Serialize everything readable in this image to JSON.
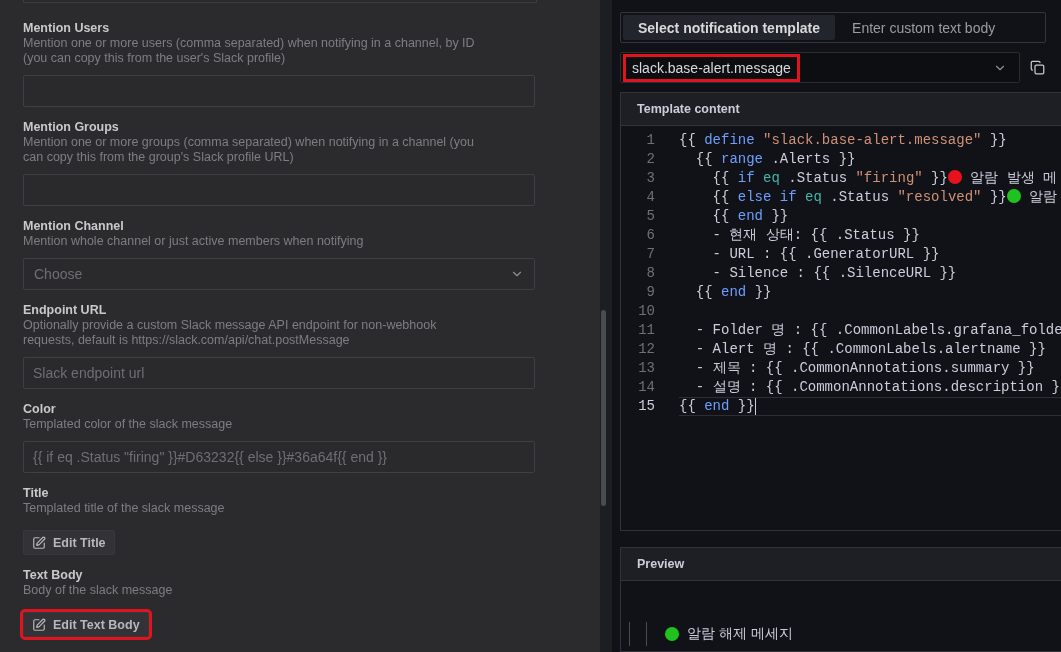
{
  "settings_form": {
    "fields": [
      {
        "kind": "input",
        "label": "Mention Users",
        "description": [
          "Mention one or more users (comma separated) when notifying in a channel, by ID",
          "(you can copy this from the user's Slack profile)"
        ]
      },
      {
        "kind": "input",
        "label": "Mention Groups",
        "description": [
          "Mention one or more groups (comma separated) when notifying in a channel (you",
          "can copy this from the group's Slack profile URL)"
        ]
      },
      {
        "kind": "select",
        "label": "Mention Channel",
        "description": [
          "Mention whole channel or just active members when notifying"
        ],
        "placeholder": "Choose"
      },
      {
        "kind": "input",
        "label": "Endpoint URL",
        "description": [
          "Optionally provide a custom Slack message API endpoint for non-webhook",
          "requests, default is https://slack.com/api/chat.postMessage"
        ],
        "placeholder": "Slack endpoint url"
      },
      {
        "kind": "input",
        "label": "Color",
        "description": [
          "Templated color of the slack message"
        ],
        "placeholder": "{{ if eq .Status \"firing\" }}#D63232{{ else }}#36a64f{{ end }}"
      },
      {
        "kind": "button",
        "label": "Title",
        "description": [
          "Templated title of the slack message"
        ],
        "button": "Edit Title",
        "highlighted": false
      },
      {
        "kind": "button",
        "label": "Text Body",
        "description": [
          "Body of the slack message"
        ],
        "button": "Edit Text Body",
        "highlighted": true
      }
    ]
  },
  "template_editor": {
    "tabs": [
      {
        "label": "Select notification template",
        "selected": true
      },
      {
        "label": "Enter custom text body",
        "selected": false
      }
    ],
    "template_select": {
      "value": "slack.base-alert.message",
      "highlighted": true
    },
    "template_content": {
      "title": "Template content",
      "lines": [
        {
          "number": "1",
          "current": false,
          "segments": [
            {
              "kind": "plain",
              "text": "{{ "
            },
            {
              "kind": "keyword",
              "text": "define"
            },
            {
              "kind": "string",
              "text": " \"slack.base-alert.message\""
            },
            {
              "kind": "plain",
              "text": " }}"
            }
          ]
        },
        {
          "number": "2",
          "current": false,
          "segments": [
            {
              "kind": "plain",
              "text": "  {{ "
            },
            {
              "kind": "keyword",
              "text": "range"
            },
            {
              "kind": "plain",
              "text": " .Alerts }}"
            }
          ]
        },
        {
          "number": "3",
          "current": false,
          "segments": [
            {
              "kind": "plain",
              "text": "    {{ "
            },
            {
              "kind": "keyword",
              "text": "if"
            },
            {
              "kind": "function",
              "text": " eq"
            },
            {
              "kind": "plain",
              "text": " .Status "
            },
            {
              "kind": "string",
              "text": "\"firing\""
            },
            {
              "kind": "plain",
              "text": " }}"
            },
            {
              "kind": "dot",
              "color": "#e8121f"
            },
            {
              "kind": "plain",
              "text": " 알람 발생 메"
            }
          ]
        },
        {
          "number": "4",
          "current": false,
          "segments": [
            {
              "kind": "plain",
              "text": "    {{ "
            },
            {
              "kind": "keyword",
              "text": "else if"
            },
            {
              "kind": "function",
              "text": " eq"
            },
            {
              "kind": "plain",
              "text": " .Status "
            },
            {
              "kind": "string",
              "text": "\"resolved\""
            },
            {
              "kind": "plain",
              "text": " }}"
            },
            {
              "kind": "dot",
              "color": "#1ec31e"
            },
            {
              "kind": "plain",
              "text": " 알람"
            }
          ]
        },
        {
          "number": "5",
          "current": false,
          "segments": [
            {
              "kind": "plain",
              "text": "    {{ "
            },
            {
              "kind": "keyword",
              "text": "end"
            },
            {
              "kind": "plain",
              "text": " }}"
            }
          ]
        },
        {
          "number": "6",
          "current": false,
          "segments": [
            {
              "kind": "plain",
              "text": "    - 현재 상태: {{ .Status }}"
            }
          ]
        },
        {
          "number": "7",
          "current": false,
          "segments": [
            {
              "kind": "plain",
              "text": "    - URL : {{ .GeneratorURL }}"
            }
          ]
        },
        {
          "number": "8",
          "current": false,
          "segments": [
            {
              "kind": "plain",
              "text": "    - Silence : {{ .SilenceURL }}"
            }
          ]
        },
        {
          "number": "9",
          "current": false,
          "segments": [
            {
              "kind": "plain",
              "text": "  {{ "
            },
            {
              "kind": "keyword",
              "text": "end"
            },
            {
              "kind": "plain",
              "text": " }}"
            }
          ]
        },
        {
          "number": "10",
          "current": false
        },
        {
          "number": "11",
          "current": false,
          "segments": [
            {
              "kind": "plain",
              "text": "  - Folder 명 : {{ .CommonLabels.grafana_folde"
            }
          ]
        },
        {
          "number": "12",
          "current": false,
          "segments": [
            {
              "kind": "plain",
              "text": "  - Alert 명 : {{ .CommonLabels.alertname }}"
            }
          ]
        },
        {
          "number": "13",
          "current": false,
          "segments": [
            {
              "kind": "plain",
              "text": "  - 제목 : {{ .CommonAnnotations.summary }}"
            }
          ]
        },
        {
          "number": "14",
          "current": false,
          "segments": [
            {
              "kind": "plain",
              "text": "  - 설명 : {{ .CommonAnnotations.description }"
            }
          ]
        },
        {
          "number": "15",
          "current": true,
          "segments": [
            {
              "kind": "plain",
              "text": "{{ "
            },
            {
              "kind": "keyword",
              "text": "end"
            },
            {
              "kind": "plain",
              "text": " }}"
            }
          ]
        }
      ]
    },
    "preview": {
      "title": "Preview",
      "lines": [
        {
          "color": "#1ec31e",
          "text": "알람 해제 메세지"
        }
      ]
    }
  }
}
